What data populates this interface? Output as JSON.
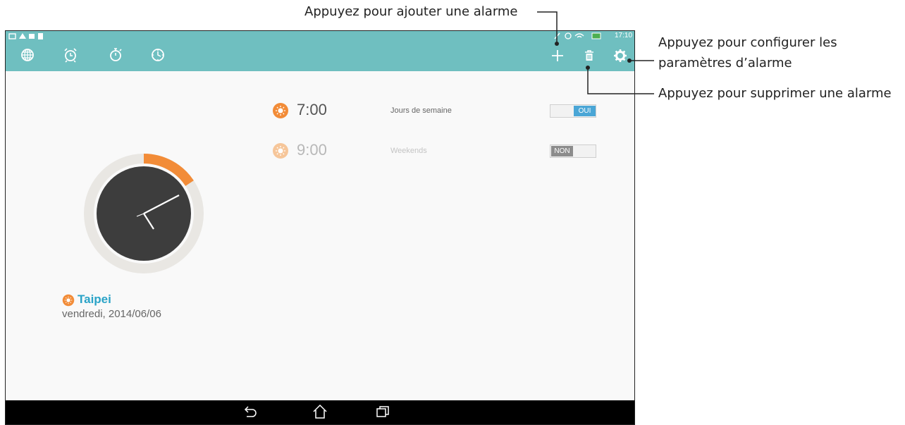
{
  "status_bar": {
    "time": "17:10"
  },
  "toolbar": {
    "tabs": [
      {
        "icon": "globe-icon"
      },
      {
        "icon": "alarm-clock-icon"
      },
      {
        "icon": "stopwatch-icon"
      },
      {
        "icon": "timer-icon"
      }
    ],
    "actions": [
      {
        "icon": "plus-icon"
      },
      {
        "icon": "trash-icon"
      },
      {
        "icon": "gear-icon"
      }
    ]
  },
  "alarms": [
    {
      "time": "7:00",
      "days": "Jours de semaine",
      "toggle_label": "OUI",
      "enabled": true
    },
    {
      "time": "9:00",
      "days": "Weekends",
      "toggle_label": "NON",
      "enabled": false
    }
  ],
  "clock": {
    "city": "Taipei",
    "date": "vendredi, 2014/06/06",
    "ring_color": "#f28c38"
  },
  "callouts": {
    "add": "Appuyez pour ajouter une alarme",
    "settings_line1": "Appuyez pour configurer les",
    "settings_line2": "paramètres d’alarme",
    "delete": "Appuyez pour supprimer une alarme"
  },
  "nav": [
    {
      "icon": "back-icon"
    },
    {
      "icon": "home-icon"
    },
    {
      "icon": "recent-apps-icon"
    }
  ],
  "colors": {
    "accent": "#6fbfc0",
    "orange": "#f28c38",
    "toggle_on": "#4aa6d6",
    "toggle_off": "#8c8c8c",
    "city": "#2aa3c7"
  }
}
